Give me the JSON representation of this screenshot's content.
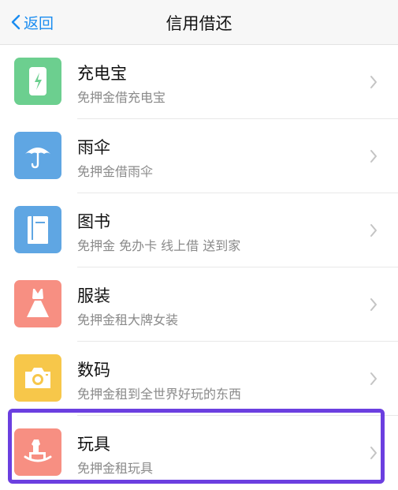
{
  "nav": {
    "back_label": "返回",
    "title": "信用借还"
  },
  "items": [
    {
      "title": "充电宝",
      "subtitle": "免押金借充电宝",
      "icon": "power-bank-icon",
      "color": "#6ccf8f"
    },
    {
      "title": "雨伞",
      "subtitle": "免押金借雨伞",
      "icon": "umbrella-icon",
      "color": "#5fa6e3"
    },
    {
      "title": "图书",
      "subtitle": "免押金 免办卡 线上借 送到家",
      "icon": "book-icon",
      "color": "#5fa6e3"
    },
    {
      "title": "服装",
      "subtitle": "免押金租大牌女装",
      "icon": "dress-icon",
      "color": "#f78f82"
    },
    {
      "title": "数码",
      "subtitle": "免押金租到全世界好玩的东西",
      "icon": "camera-icon",
      "color": "#f7c74a"
    },
    {
      "title": "玩具",
      "subtitle": "免押金租玩具",
      "icon": "rocking-horse-icon",
      "color": "#f78f82"
    }
  ],
  "highlight_color": "#6b3fe0"
}
